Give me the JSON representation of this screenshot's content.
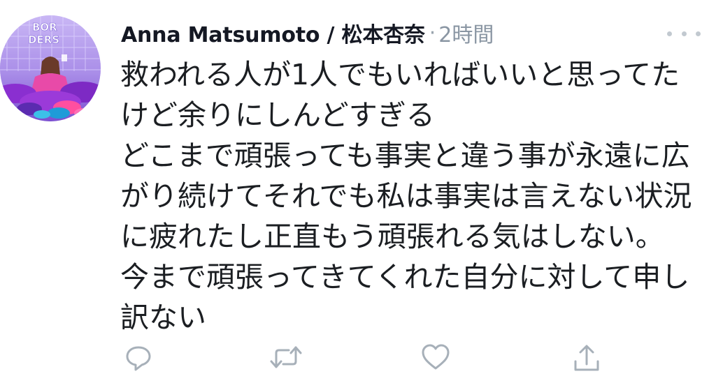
{
  "tweet": {
    "author_name": "Anna Matsumoto / 松本杏奈",
    "separator": "·",
    "timestamp": "2時間",
    "lines": [
      "救われる人が1人でもいればいいと思ってた",
      "けど余りにしんどすぎる",
      "どこまで頑張っても事実と違う事が永遠に広",
      "がり続けてそれでも私は事実は言えない状況",
      "に疲れたし正直もう頑張れる気はしない。",
      "今まで頑張ってきてくれた自分に対して申し",
      "訳ない"
    ],
    "avatar": {
      "sign_text_1": "BOR",
      "sign_text_2": "DERS"
    }
  },
  "actions": [
    {
      "name": "reply",
      "icon": "reply-icon"
    },
    {
      "name": "retweet",
      "icon": "retweet-icon"
    },
    {
      "name": "like",
      "icon": "heart-icon"
    },
    {
      "name": "share",
      "icon": "share-icon"
    }
  ],
  "colors": {
    "text": "#1b1e22",
    "muted": "#8a96a3",
    "icon": "#a7b0b9"
  }
}
